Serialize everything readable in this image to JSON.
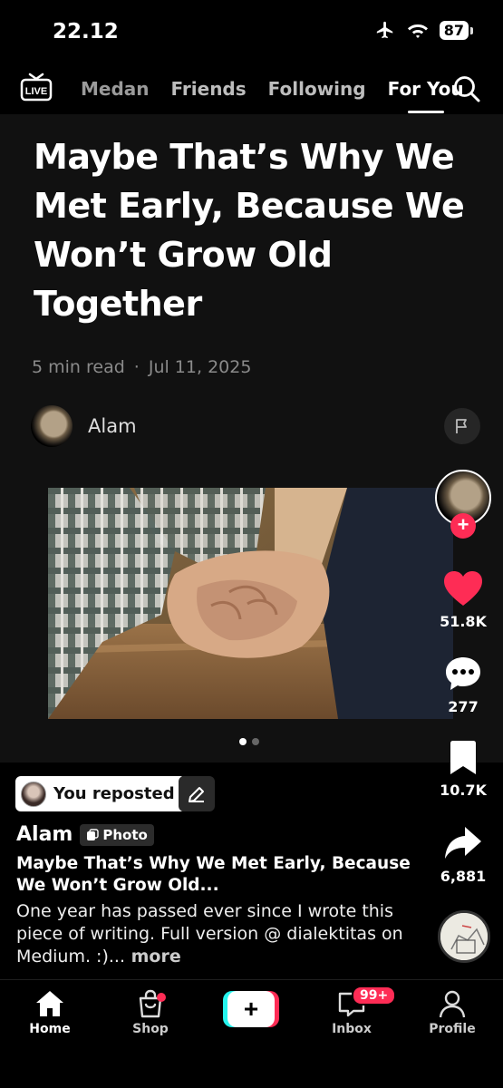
{
  "status_bar": {
    "time": "22.12",
    "battery": "87"
  },
  "top_nav": {
    "live_label": "LIVE",
    "tabs": [
      {
        "label": "Medan"
      },
      {
        "label": "Friends"
      },
      {
        "label": "Following"
      },
      {
        "label": "For You",
        "active": true
      }
    ]
  },
  "article": {
    "title": "Maybe That’s Why We Met Early, Because We Won’t Grow Old Together",
    "read_time": "5  min read",
    "separator": "·",
    "date": "Jul 11, 2025",
    "author": "Alam"
  },
  "actions": {
    "likes": "51.8K",
    "comments": "277",
    "saves": "10.7K",
    "shares": "6,881",
    "like_color": "#fe2c55",
    "follow_color": "#fe2c55"
  },
  "caption": {
    "repost_label": "You reposted",
    "author": "Alam",
    "type_badge": "Photo",
    "title": "Maybe That’s Why We Met Early, Because We Won’t Grow Old...",
    "description": "One year has passed ever since I wrote this piece of writing. Full version @ dialektitas on Medium. :)...",
    "more_label": " more"
  },
  "bottom_nav": {
    "home": "Home",
    "shop": "Shop",
    "create_symbol": "+",
    "inbox": "Inbox",
    "inbox_badge": "99+",
    "profile": "Profile"
  },
  "carousel": {
    "pages": 2,
    "current": 1
  }
}
